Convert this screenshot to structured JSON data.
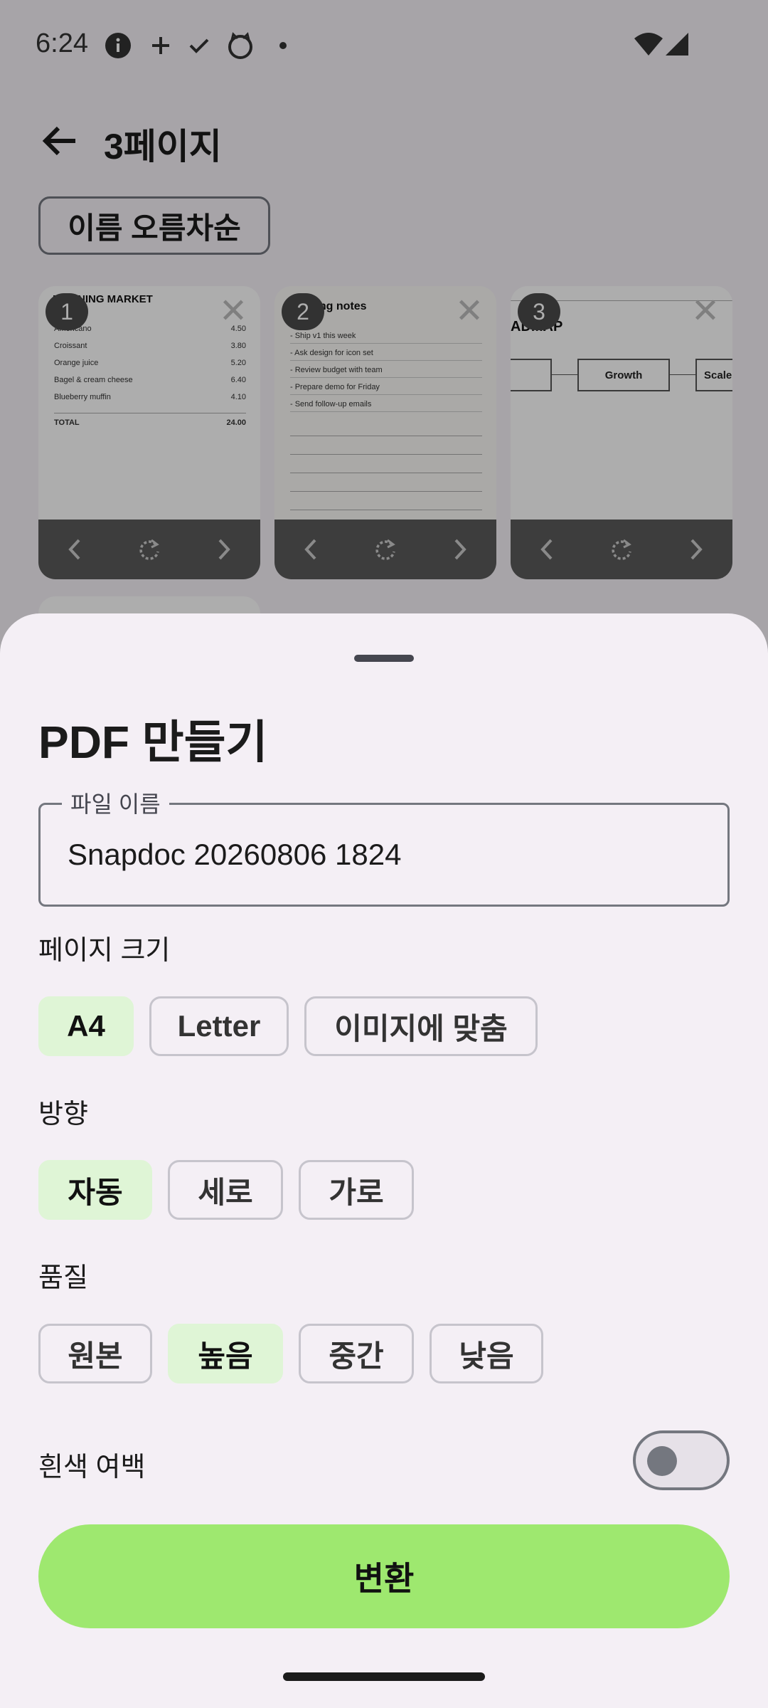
{
  "status_bar": {
    "time": "6:24",
    "icons": [
      "info-icon",
      "plus-icon",
      "check-icon",
      "cat-icon",
      "dot-icon",
      "wifi-icon",
      "signal-icon"
    ]
  },
  "header": {
    "title": "3페이지"
  },
  "sort": {
    "label": "이름 오름차순"
  },
  "pages": [
    {
      "number": "1",
      "doc": {
        "title": "MORNING MARKET",
        "items": [
          {
            "name": "Americano",
            "price": "4.50"
          },
          {
            "name": "Croissant",
            "price": "3.80"
          },
          {
            "name": "Orange juice",
            "price": "5.20"
          },
          {
            "name": "Bagel & cream cheese",
            "price": "6.40"
          },
          {
            "name": "Blueberry muffin",
            "price": "4.10"
          }
        ],
        "total_label": "TOTAL",
        "total_value": "24.00"
      }
    },
    {
      "number": "2",
      "doc": {
        "title": "Meeting notes",
        "items": [
          "- Ship v1 this week",
          "- Ask design for icon set",
          "- Review budget with team",
          "- Prepare demo for Friday",
          "- Send follow-up emails"
        ]
      }
    },
    {
      "number": "3",
      "doc": {
        "title": "ADMAP",
        "boxes": [
          "Growth",
          "Scale"
        ]
      }
    }
  ],
  "sheet": {
    "title": "PDF 만들기",
    "file_name_label": "파일 이름",
    "file_name_value": "Snapdoc 20260806 1824",
    "page_size_label": "페이지 크기",
    "page_size_options": [
      "A4",
      "Letter",
      "이미지에 맞춤"
    ],
    "page_size_selected": "A4",
    "orientation_label": "방향",
    "orientation_options": [
      "자동",
      "세로",
      "가로"
    ],
    "orientation_selected": "자동",
    "quality_label": "품질",
    "quality_options": [
      "원본",
      "높음",
      "중간",
      "낮음"
    ],
    "quality_selected": "높음",
    "white_margin_label": "흰색 여백",
    "white_margin_on": false,
    "convert_label": "변환"
  },
  "colors": {
    "accent": "#9ee86f",
    "chip_selected": "#dff5d6",
    "sheet_bg": "#f4eff5"
  }
}
